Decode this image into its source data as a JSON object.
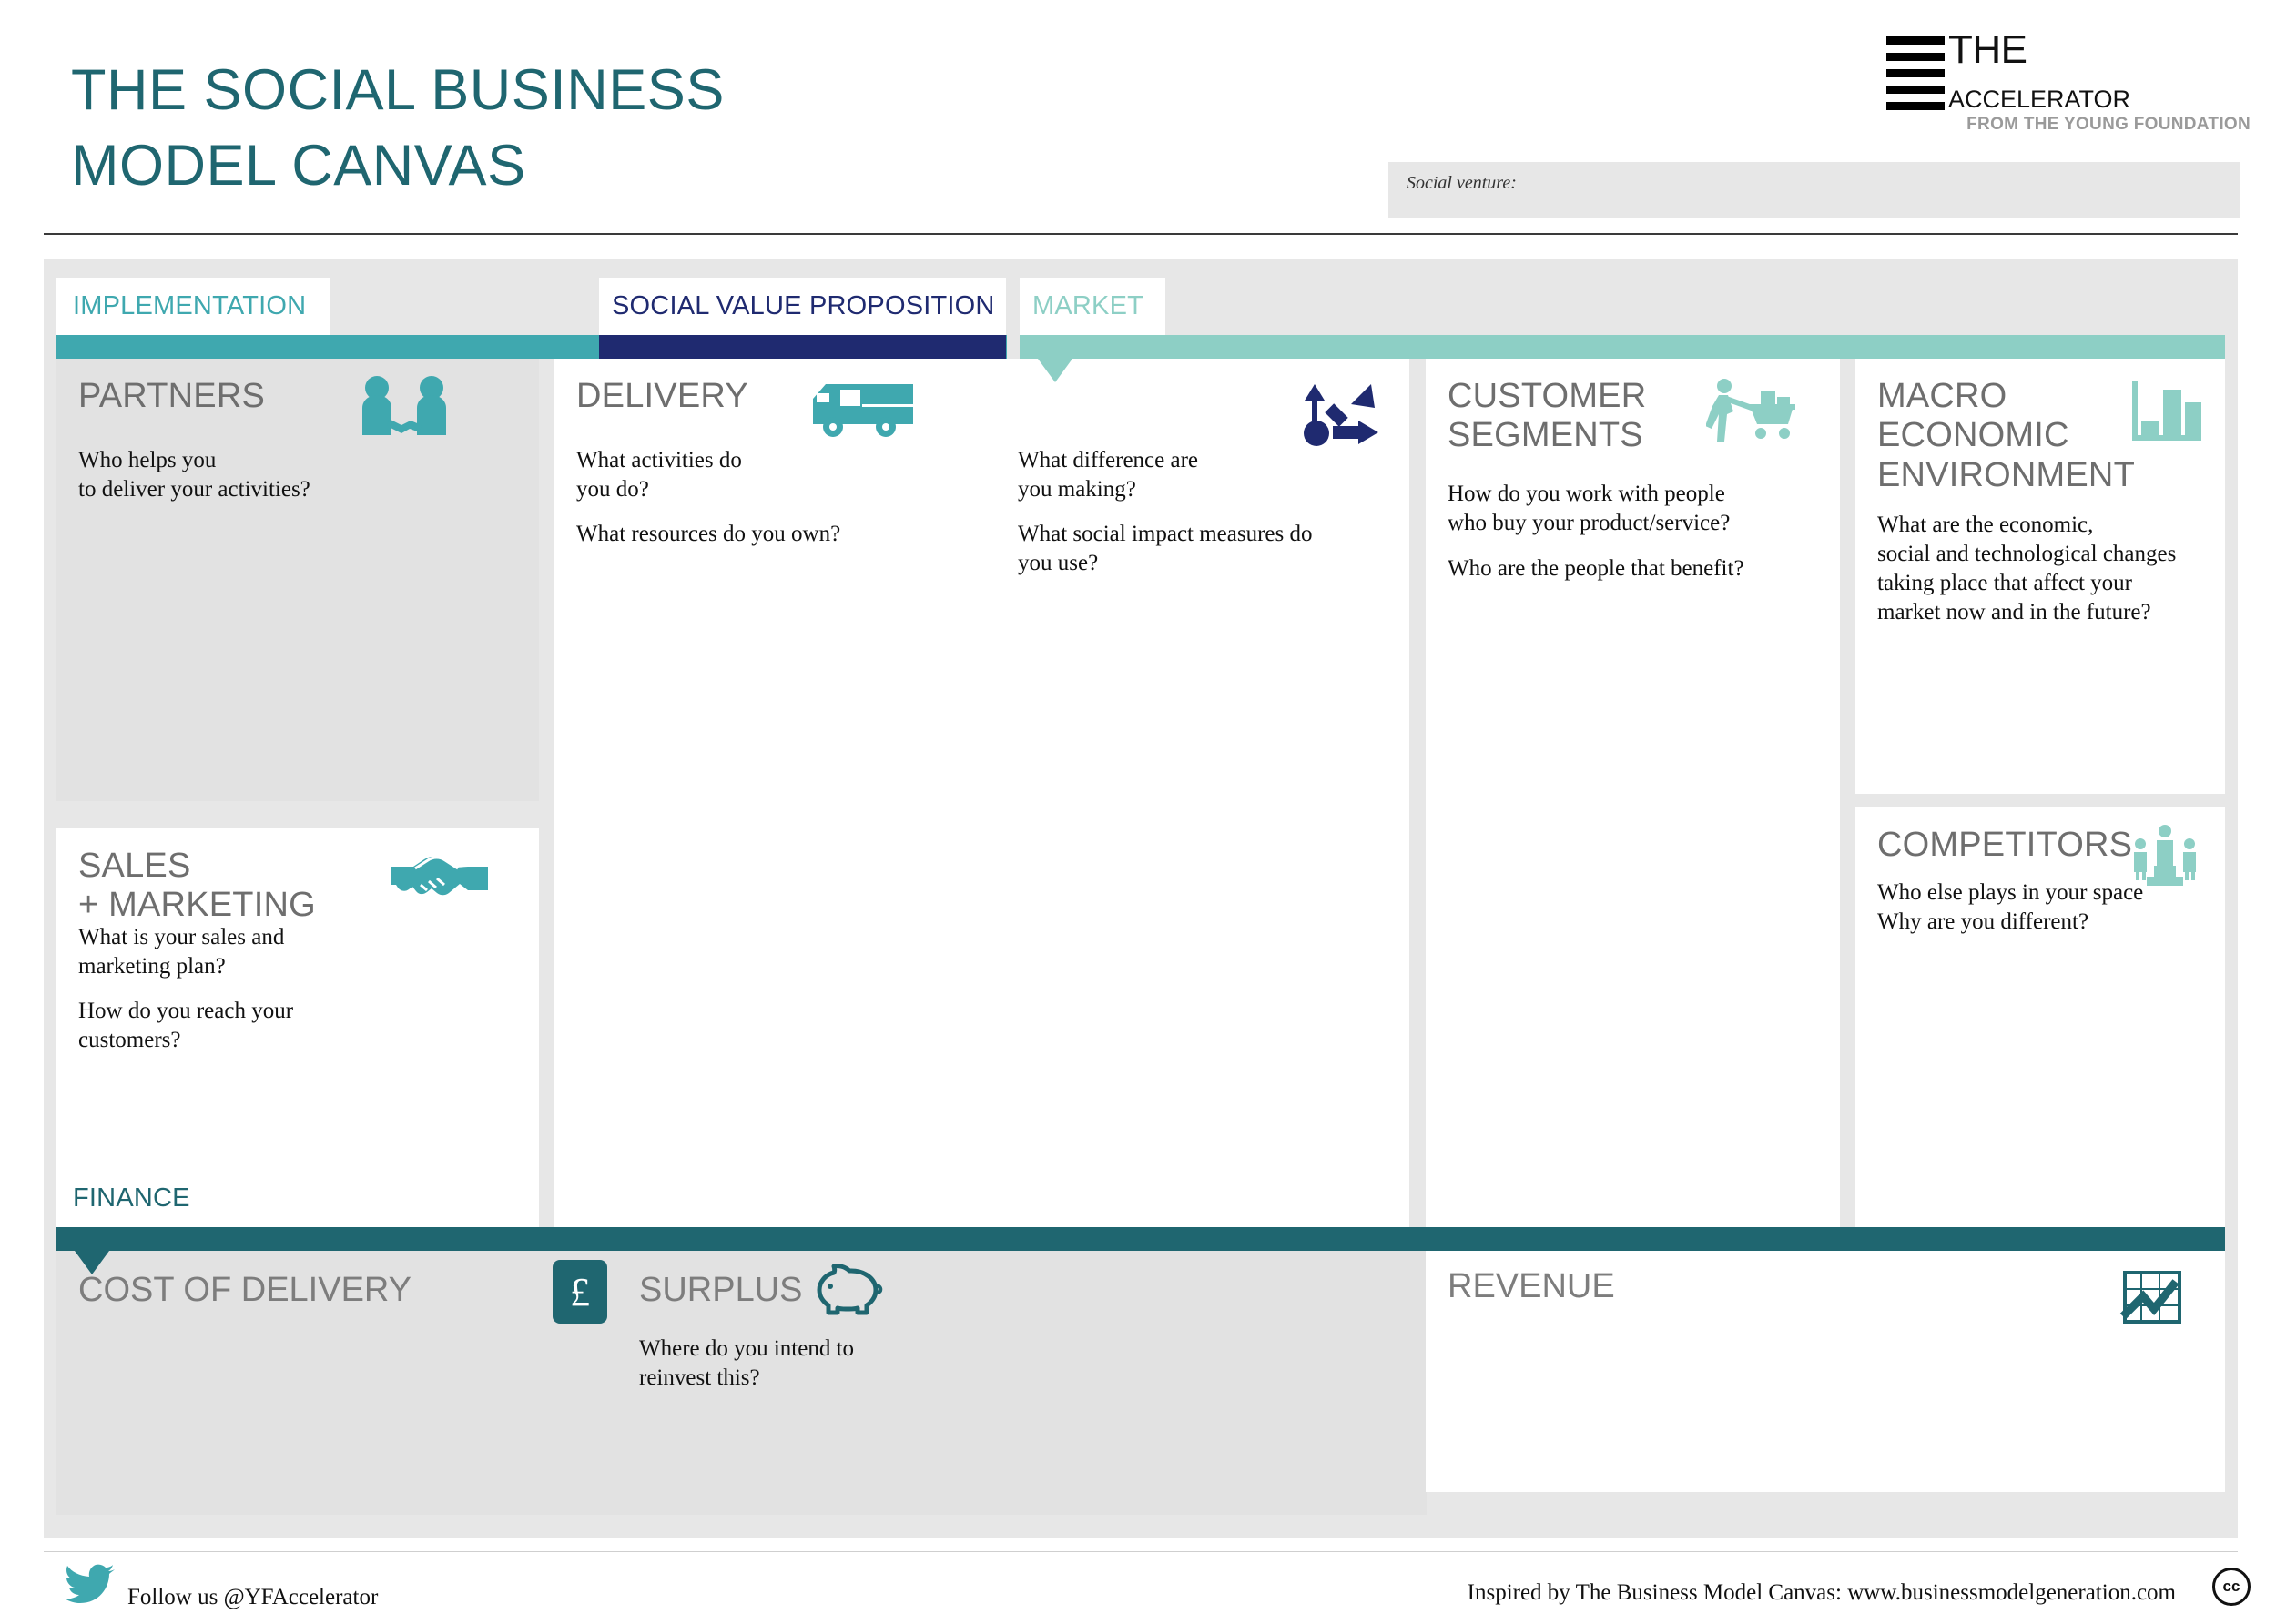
{
  "header": {
    "title": "THE SOCIAL BUSINESS\nMODEL CANVAS",
    "venture_label": "Social venture:",
    "logo": {
      "line1": "THE",
      "line2": "ACCELERATOR",
      "line3": "FROM THE YOUNG FOUNDATION",
      "icon": "stacked-bars-logo"
    }
  },
  "sections": {
    "implementation": {
      "label": "IMPLEMENTATION",
      "color": "#3FA8AF"
    },
    "social_value_proposition": {
      "label": "SOCIAL VALUE PROPOSITION",
      "color": "#1F2A70"
    },
    "market": {
      "label": "MARKET",
      "color": "#8DCFC5"
    },
    "finance": {
      "label": "FINANCE",
      "color": "#1F6670"
    }
  },
  "panels": {
    "partners": {
      "title": "PARTNERS",
      "icon": "two-people-handshake-icon",
      "body": "Who helps you\nto deliver your activities?"
    },
    "sales_marketing": {
      "title": "SALES\n+ MARKETING",
      "icon": "handshake-icon",
      "body1": "What is your sales and\nmarketing plan?",
      "body2": "How do you reach your\ncustomers?"
    },
    "delivery": {
      "title": "DELIVERY",
      "icon": "delivery-truck-icon",
      "body1": "What activities do\nyou do?",
      "body2": "What resources do you own?"
    },
    "social_value_proposition": {
      "icon": "impact-flow-icon",
      "body1": "What difference are\nyou making?",
      "body2": "What social impact measures do\nyou use?"
    },
    "customer_segments": {
      "title": "CUSTOMER\nSEGMENTS",
      "icon": "shopping-cart-person-icon",
      "body1": "How do you work with people\nwho buy your product/service?",
      "body2": "Who are the people that benefit?"
    },
    "macro_economic_environment": {
      "title": "MACRO\nECONOMIC\nENVIRONMENT",
      "icon": "bar-chart-icon",
      "body": "What are the economic,\nsocial and technological changes\ntaking place that affect your\nmarket now and in the future?"
    },
    "competitors": {
      "title": "COMPETITORS",
      "icon": "podium-people-icon",
      "body": "Who else plays in your space\nWhy are you different?"
    },
    "cost_of_delivery": {
      "title": "COST OF DELIVERY",
      "icon": "pound-sign-icon"
    },
    "surplus": {
      "title": "SURPLUS",
      "icon": "piggy-bank-icon",
      "body": "Where do you intend to\nreinvest this?"
    },
    "revenue": {
      "title": "REVENUE",
      "icon": "growth-chart-icon"
    }
  },
  "footer": {
    "twitter_icon": "twitter-bird-icon",
    "follow": "Follow us @YFAccelerator",
    "credit": "Inspired by The Business Model Canvas: www.businessmodelgeneration.com",
    "license_badge": "cc"
  }
}
